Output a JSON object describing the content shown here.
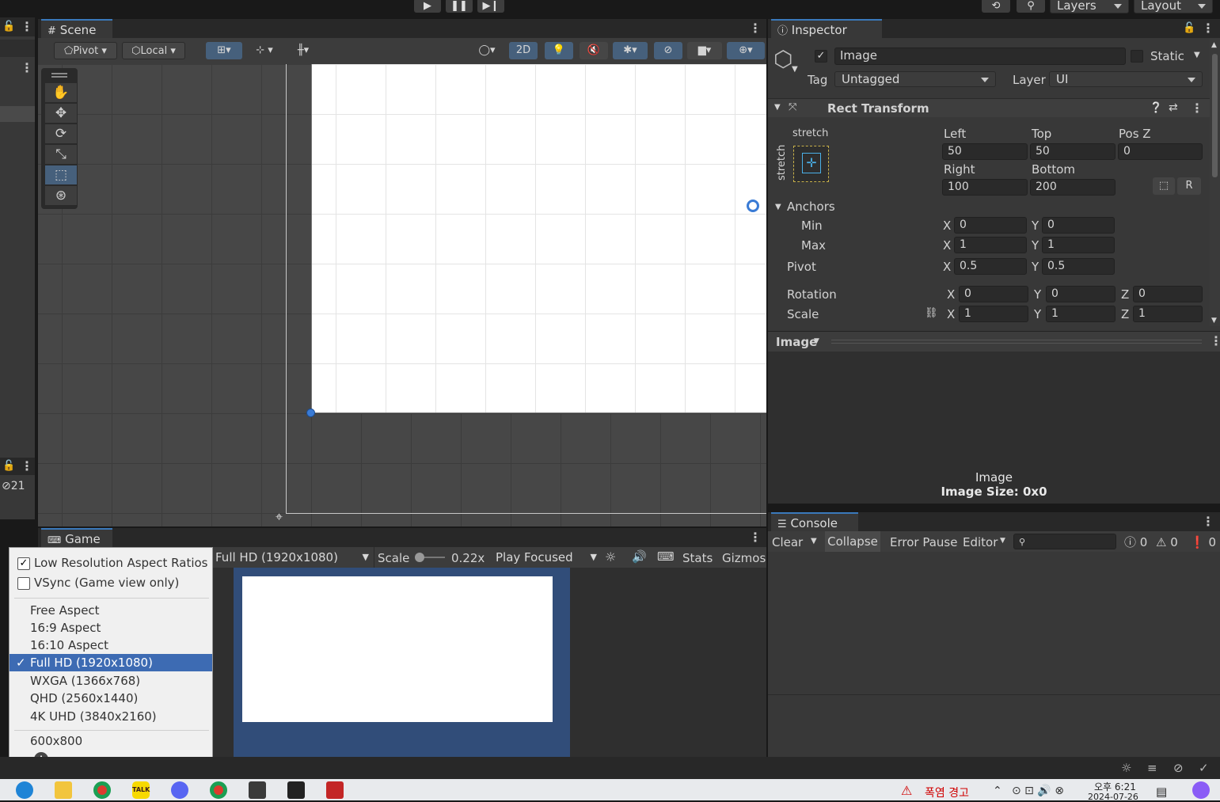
{
  "toolbar": {
    "play_icon": "play-icon",
    "pause_icon": "pause-icon",
    "step_icon": "step-icon",
    "history_icon": "history-icon",
    "search_icon": "search-icon",
    "layers_label": "Layers",
    "layout_label": "Layout"
  },
  "scene": {
    "tab_label": "Scene",
    "pivot_label": "Pivot",
    "local_label": "Local",
    "mode_2d_label": "2D",
    "hidden_count": "21"
  },
  "game": {
    "tab_label": "Game",
    "resolution_label": "Full HD (1920x1080)",
    "scale_label": "Scale",
    "scale_value": "0.22x",
    "play_focused_label": "Play Focused",
    "stats_label": "Stats",
    "gizmos_label": "Gizmos"
  },
  "aspect_menu": {
    "low_res_label": "Low Resolution Aspect Ratios",
    "low_res_checked": true,
    "vsync_label": "VSync (Game view only)",
    "vsync_checked": false,
    "items": [
      {
        "label": "Free Aspect",
        "selected": false
      },
      {
        "label": "16:9 Aspect",
        "selected": false
      },
      {
        "label": "16:10 Aspect",
        "selected": false
      },
      {
        "label": "Full HD (1920x1080)",
        "selected": true
      },
      {
        "label": "WXGA (1366x768)",
        "selected": false
      },
      {
        "label": "QHD (2560x1440)",
        "selected": false
      },
      {
        "label": "4K UHD (3840x2160)",
        "selected": false
      }
    ],
    "custom_item": "600x800",
    "selected_mark": "✓"
  },
  "inspector": {
    "tab_label": "Inspector",
    "object_name": "Image",
    "static_label": "Static",
    "tag_label": "Tag",
    "tag_value": "Untagged",
    "layer_label": "Layer",
    "layer_value": "UI",
    "rect_transform": {
      "title": "Rect Transform",
      "stretch_top": "stretch",
      "stretch_side": "stretch",
      "left_label": "Left",
      "left_value": "50",
      "top_label": "Top",
      "top_value": "50",
      "posz_label": "Pos Z",
      "posz_value": "0",
      "right_label": "Right",
      "right_value": "100",
      "bottom_label": "Bottom",
      "bottom_value": "200",
      "anchors_label": "Anchors",
      "min_label": "Min",
      "min_x": "0",
      "min_y": "0",
      "max_label": "Max",
      "max_x": "1",
      "max_y": "1",
      "pivot_label": "Pivot",
      "pivot_x": "0.5",
      "pivot_y": "0.5",
      "rotation_label": "Rotation",
      "rot_x": "0",
      "rot_y": "0",
      "rot_z": "0",
      "scale_label": "Scale",
      "scale_x": "1",
      "scale_y": "1",
      "scale_z": "1",
      "x_label": "X",
      "y_label": "Y",
      "z_label": "Z"
    },
    "preview_title": "Image",
    "preview_name": "Image",
    "preview_size": "Image Size: 0x0"
  },
  "console": {
    "tab_label": "Console",
    "clear_label": "Clear",
    "collapse_label": "Collapse",
    "error_pause_label": "Error Pause",
    "editor_label": "Editor",
    "info_count": "0",
    "warning_count": "0",
    "error_count": "0"
  },
  "taskbar": {
    "warning_text": "폭염 경고",
    "time": "오후 6:21",
    "date": "2024-07-26"
  }
}
